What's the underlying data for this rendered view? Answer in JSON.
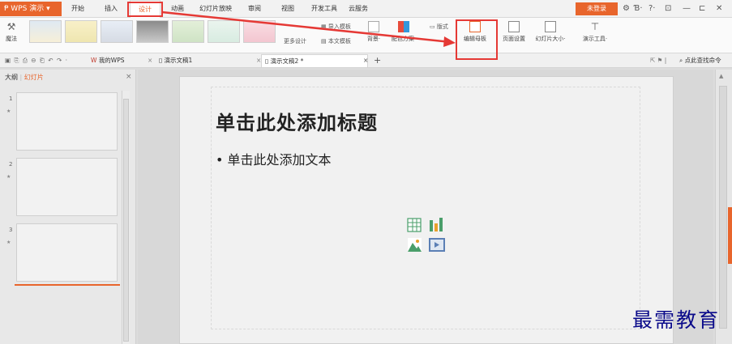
{
  "app": {
    "brand": "WPS 演示"
  },
  "menu": {
    "tabs": [
      "开始",
      "插入",
      "设计",
      "动画",
      "幻灯片放映",
      "审阅",
      "视图",
      "开发工具",
      "云服务"
    ]
  },
  "titlebar": {
    "login": "未登录"
  },
  "ribbon": {
    "magic": "魔法",
    "more_design": "更多设计",
    "import_template": "导入模板",
    "text_template": "本文模板",
    "background": "背景",
    "color_scheme": "配色方案",
    "format": "版式",
    "edit_master": "编辑母板",
    "page_setup": "页面设置",
    "slide_size": "幻灯片大小",
    "presentation_tools": "演示工具"
  },
  "doc_tabs": [
    "我的WPS",
    "演示文稿1",
    "演示文稿2 *"
  ],
  "search": {
    "label": "点此查找命令"
  },
  "left_panel": {
    "tab_outline": "大纲",
    "tab_slides": "幻灯片",
    "slides": [
      "1",
      "2",
      "3"
    ]
  },
  "slide": {
    "title": "单击此处添加标题",
    "body": "单击此处添加文本"
  },
  "watermark": "最需教育",
  "colors": {
    "accent": "#e8652c",
    "highlight": "#e53935"
  }
}
